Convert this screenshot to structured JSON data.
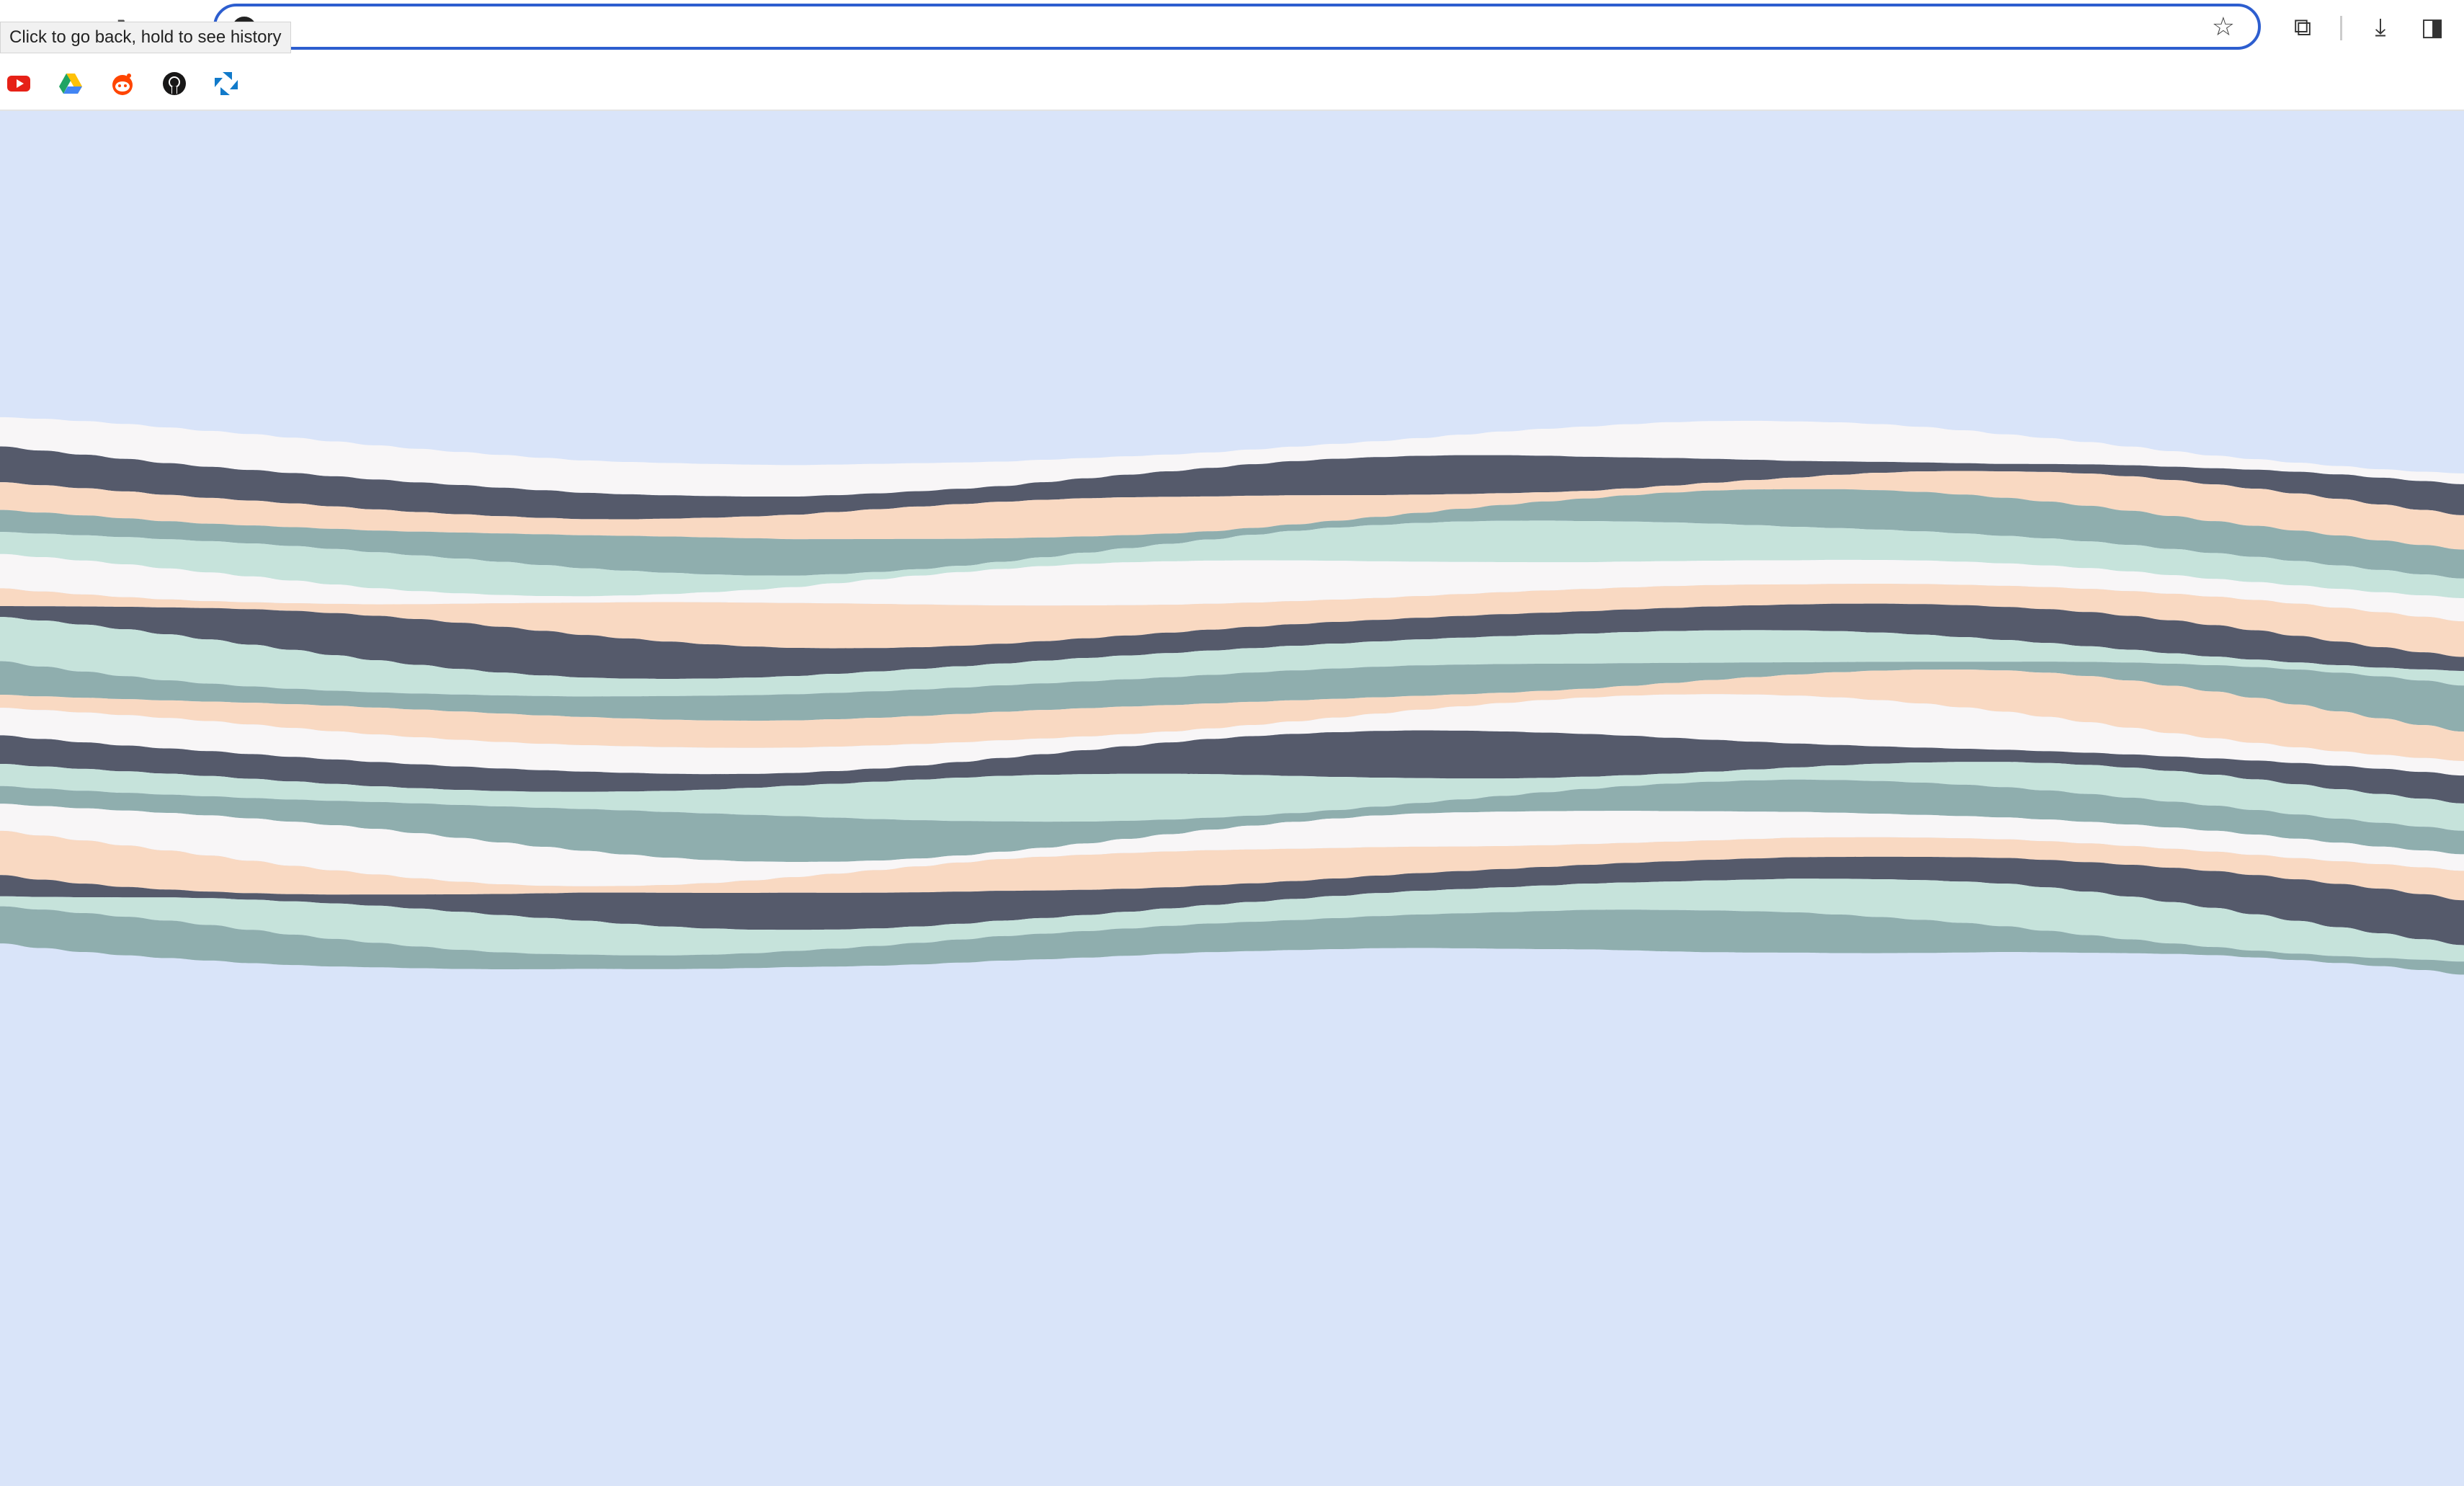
{
  "browser": {
    "tooltip": "Click to go back, hold to see history",
    "address_value": "",
    "icons": {
      "back": "arrow-left-icon",
      "forward": "arrow-right-icon",
      "reload": "reload-icon",
      "home": "home-icon",
      "bookmark_star": "star-icon",
      "extensions": "puzzle-icon",
      "downloads": "download-icon",
      "side_panel": "side-panel-icon"
    }
  },
  "bookmarks": [
    {
      "icon": "youtube-icon",
      "color": "#ff0000"
    },
    {
      "icon": "google-drive-icon",
      "color": "#1fa463"
    },
    {
      "icon": "reddit-icon",
      "color": "#ff4500"
    },
    {
      "icon": "github-icon",
      "color": "#181717"
    },
    {
      "icon": "chase-icon",
      "color": "#117aca"
    }
  ],
  "page": {
    "background_color": "#d9e4f9",
    "streamgraph": {
      "layer_colors": [
        "#555a6b",
        "#8faeae",
        "#c6e3db",
        "#f9d9c2",
        "#f8f6f7"
      ]
    }
  }
}
